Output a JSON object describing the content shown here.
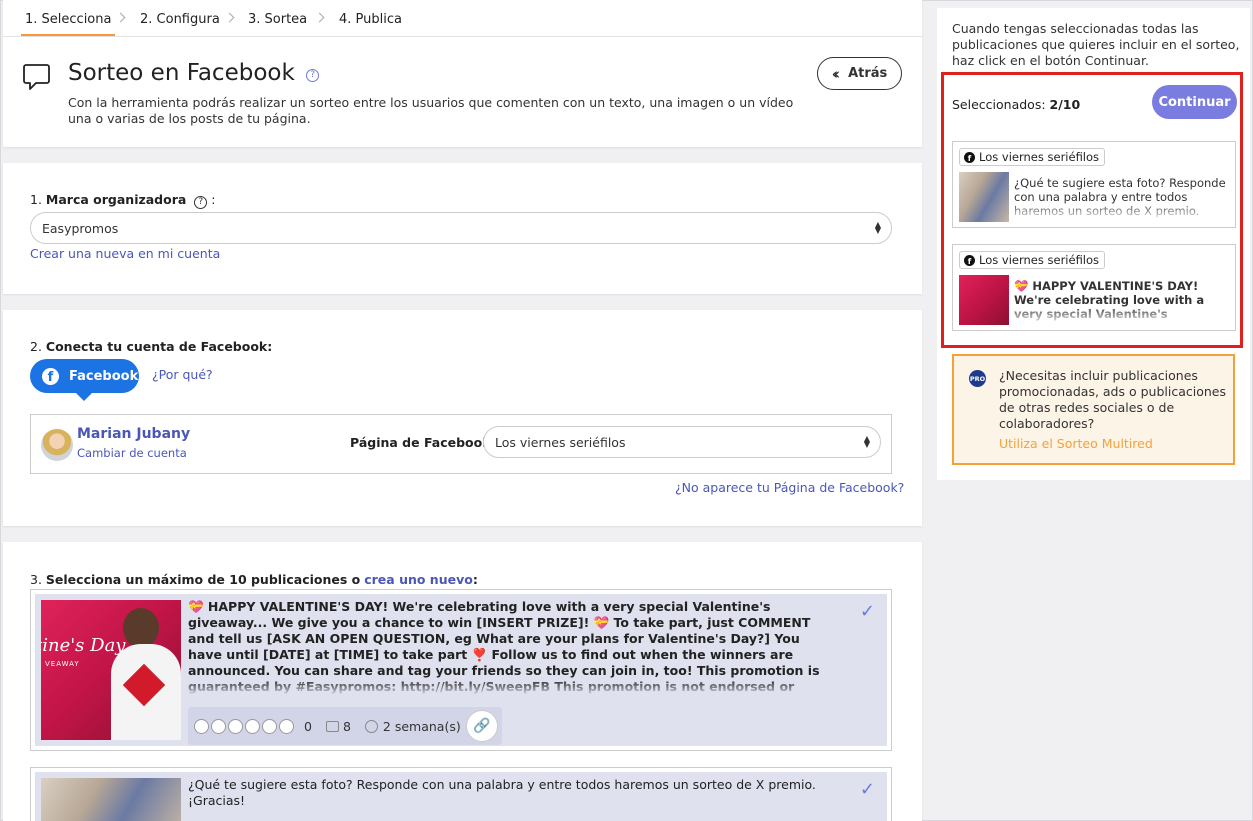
{
  "steps": [
    {
      "label": "1. Selecciona",
      "active": true
    },
    {
      "label": "2. Configura",
      "active": false
    },
    {
      "label": "3. Sortea",
      "active": false
    },
    {
      "label": "4. Publica",
      "active": false
    }
  ],
  "header": {
    "title": "Sorteo en Facebook",
    "description": "Con la herramienta podrás realizar un sorteo entre los usuarios que comenten con un texto, una imagen o un vídeo una o varias de los posts de tu página.",
    "back_label": "Atrás"
  },
  "brand": {
    "label_num": "1.",
    "label_bold": "Marca organizadora",
    "label_colon": ":",
    "selected": "Easypromos",
    "create_link": "Crear una nueva en mi cuenta"
  },
  "connect": {
    "label_num": "2.",
    "label_bold": "Conecta tu cuenta de Facebook:",
    "fb_button": "Facebook",
    "why_link": "¿Por qué?",
    "user_name": "Marian Jubany",
    "change_account": "Cambiar de cuenta",
    "page_label": "Página de Facebook:",
    "page_selected": "Los viernes seriéfilos",
    "missing_page_link": "¿No aparece tu Página de Facebook?"
  },
  "posts_section": {
    "label_num": "3.",
    "label_bold": "Selecciona un máximo de 10 publicaciones o",
    "create_link": "crea uno nuevo",
    "label_colon": ":"
  },
  "posts": [
    {
      "text": "💝 HAPPY VALENTINE'S DAY! We're celebrating love with a very special Valentine's giveaway... We give you a chance to win [INSERT PRIZE]! 💝 To take part, just COMMENT and tell us [ASK AN OPEN QUESTION, eg What are your plans for Valentine's Day?] You have until [DATE] at [TIME] to take part ❣️ Follow us to find out when the winners are announced. You can share and tag your friends so they can join in, too! This promotion is guaranteed by #Easypromos: http://bit.ly/SweepFB This promotion is not endorsed or sponsored by Facebook.",
      "image_caption": "tine's Day",
      "image_sub": "VEAWAY",
      "reactions": "0",
      "comments": "8",
      "age": "2 semana(s)"
    },
    {
      "text": "¿Qué te sugiere esta foto? Responde con una palabra y entre todos haremos un sorteo de X premio. ¡Gracias!"
    }
  ],
  "side": {
    "info": "Cuando tengas seleccionadas todas las publicaciones que quieres incluir en el sorteo, haz click en el botón Continuar.",
    "selected_label": "Seleccionados:",
    "selected_count": "2/10",
    "continue_label": "Continuar",
    "selected_posts": [
      {
        "page": "Los viernes seriéfilos",
        "text": "¿Qué te sugiere esta foto? Responde con una palabra y entre todos haremos un sorteo de X premio. ¡Gracias!"
      },
      {
        "page": "Los viernes seriéfilos",
        "text": "💝 HAPPY VALENTINE'S DAY! We're celebrating love with a very special Valentine's giveaway... We give you a chance to win [INSERT PRIZE]!"
      }
    ],
    "pro_badge": "PRO",
    "pro_text": "¿Necesitas incluir publicaciones promocionadas, ads o publicaciones de otras redes sociales o de colaboradores?",
    "pro_link": "Utiliza el Sorteo Multired"
  },
  "colors": {
    "accent": "#6c7ae0",
    "facebook": "#1c74e4",
    "highlight": "#e0201a",
    "pro": "#f3a23a"
  }
}
